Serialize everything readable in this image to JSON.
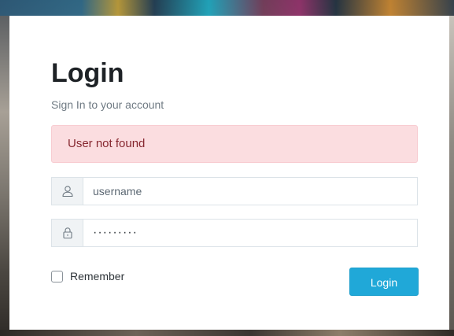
{
  "login": {
    "title": "Login",
    "subtitle": "Sign In to your account",
    "error_message": "User not found",
    "username": {
      "placeholder": "username",
      "value": "",
      "icon": "user-icon"
    },
    "password": {
      "placeholder": "",
      "value": "·········",
      "icon": "lock-icon"
    },
    "remember_label": "Remember",
    "remember_checked": false,
    "submit_label": "Login"
  },
  "colors": {
    "accent": "#20a8d8",
    "alert_background": "#fbdde0",
    "alert_text": "#86272f",
    "card_background": "#ffffff"
  }
}
